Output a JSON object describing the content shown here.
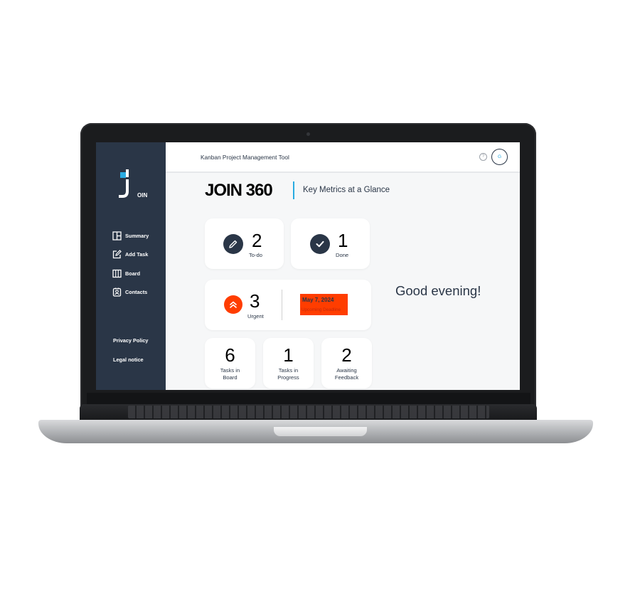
{
  "app": {
    "logo_text": "OIN",
    "header_title": "Kanban Project Management Tool",
    "help_icon": "question-mark-icon",
    "avatar_initial": "G"
  },
  "sidebar": {
    "items": [
      {
        "label": "Summary",
        "icon": "summary-icon"
      },
      {
        "label": "Add Task",
        "icon": "edit-icon"
      },
      {
        "label": "Board",
        "icon": "board-icon"
      },
      {
        "label": "Contacts",
        "icon": "contacts-icon"
      }
    ],
    "privacy_policy": "Privacy Policy",
    "legal_notice": "Legal notice"
  },
  "summary": {
    "title": "JOIN 360",
    "subtitle": "Key Metrics at a Glance",
    "todo": {
      "count": "2",
      "label": "To-do",
      "icon": "pencil-icon"
    },
    "done": {
      "count": "1",
      "label": "Done",
      "icon": "checkmark-icon"
    },
    "urgent": {
      "count": "3",
      "label": "Urgent",
      "icon": "double-chevron-up-icon"
    },
    "deadline": {
      "date": "May 7, 2024",
      "label": "Upcoming Deadline"
    },
    "tasks_in_board": {
      "count": "6",
      "label_line1": "Tasks in",
      "label_line2": "Board"
    },
    "tasks_in_progress": {
      "count": "1",
      "label_line1": "Tasks in",
      "label_line2": "Progress"
    },
    "awaiting_feedback": {
      "count": "2",
      "label_line1": "Awaiting",
      "label_line2": "Feedback"
    },
    "greeting": "Good evening!"
  },
  "colors": {
    "sidebar": "#2a3647",
    "accent": "#29abe2",
    "urgent": "#ff3d00",
    "background": "#f6f7f8"
  }
}
